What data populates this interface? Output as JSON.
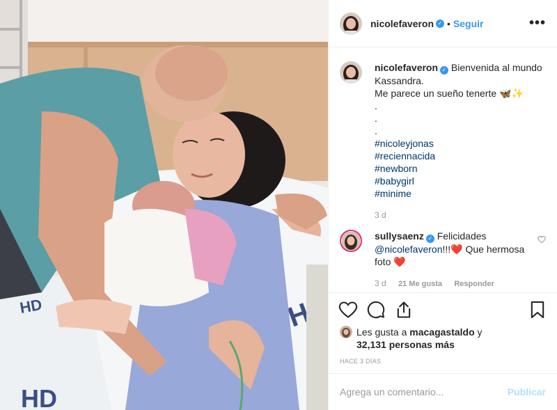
{
  "post": {
    "username": "nicolefaveron",
    "follow_label": "Seguir",
    "dot": "•",
    "more_label": "•••",
    "caption": {
      "username": "nicolefaveron",
      "line1": "Bienvenida al mundo Kassandra.",
      "line2": "Me parece un sueño tenerte 🦋✨",
      "dots": [
        ".",
        ".",
        "."
      ],
      "hashtags": [
        "#nicoleyjonas",
        "#reciennacida",
        "#newborn",
        "#babygirl",
        "#minime"
      ],
      "age": "3 d"
    },
    "comment": {
      "username": "sullysaenz",
      "text_before": "Felicidades",
      "mention": "@nicolefaveron",
      "text_after": "!!!❤️ Que hermosa foto ❤️",
      "age": "3 d",
      "likes": "21 Me gusta",
      "reply_label": "Responder"
    },
    "likes": {
      "prefix": "Les gusta a",
      "user": "macagastaldo",
      "mid": "y",
      "count": "32,131 personas más"
    },
    "timestamp": "HACE 3 DÍAS",
    "add_comment_placeholder": "Agrega un comentario...",
    "publish_label": "Publicar"
  },
  "icons": {
    "header_avatar": "profile-avatar-icon",
    "verified": "verified-badge-icon",
    "like": "heart-icon",
    "comment": "comment-bubble-icon",
    "share": "share-icon",
    "save": "bookmark-icon",
    "comment_like": "small-heart-icon"
  },
  "colors": {
    "link_blue": "#3897f0",
    "hashtag": "#003569",
    "muted": "#999999",
    "publish_disabled": "#b2dffc"
  }
}
